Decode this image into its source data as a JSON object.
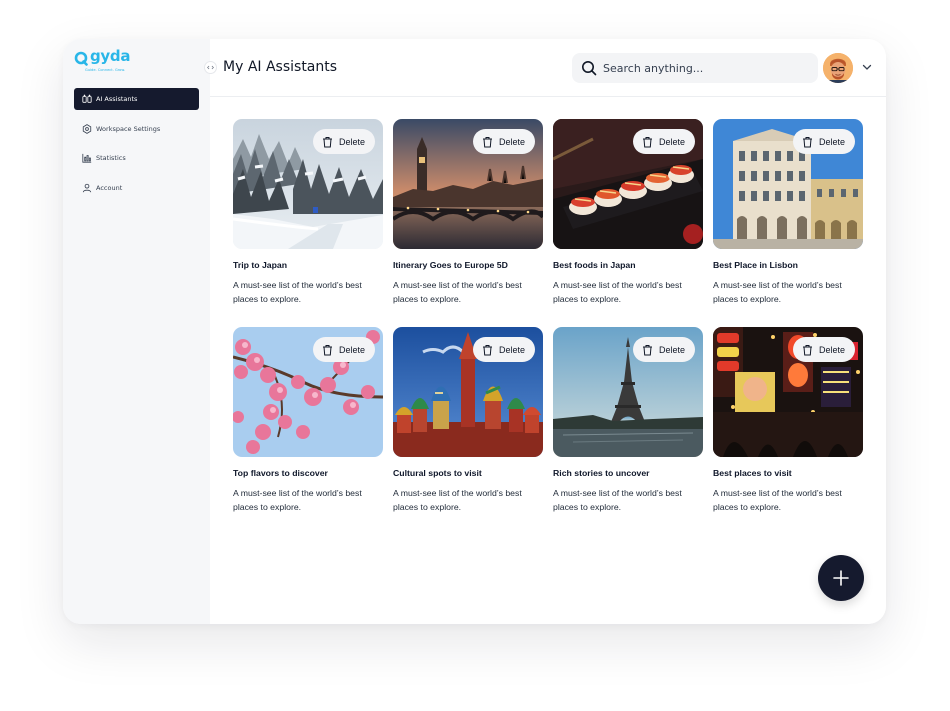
{
  "brand": {
    "name": "gyda",
    "tagline": "Guide. Connect. Grow.",
    "color": "#29b6e8"
  },
  "sidebar": {
    "items": [
      {
        "label": "AI Assistants",
        "icon": "assistants-icon",
        "active": true
      },
      {
        "label": "Workspace Settings",
        "icon": "settings-icon",
        "active": false
      },
      {
        "label": "Statistics",
        "icon": "chart-icon",
        "active": false
      },
      {
        "label": "Account",
        "icon": "user-icon",
        "active": false
      }
    ]
  },
  "header": {
    "title": "My AI Assistants",
    "search_placeholder": "Search anything..."
  },
  "cards": [
    {
      "title": "Trip to Japan",
      "desc": "A must-see list of the world’s best places to explore.",
      "delete_label": "Delete",
      "scene": "snowy-forest"
    },
    {
      "title": "Itinerary Goes to Europe 5D",
      "desc": "A must-see list of the world’s best places to explore.",
      "delete_label": "Delete",
      "scene": "london-bridge-sunset"
    },
    {
      "title": "Best foods in Japan",
      "desc": "A must-see list of the world’s best places to explore.",
      "delete_label": "Delete",
      "scene": "sushi"
    },
    {
      "title": "Best Place in Lisbon",
      "desc": "A must-see list of the world’s best places to explore.",
      "delete_label": "Delete",
      "scene": "lisbon-building"
    },
    {
      "title": "Top flavors to discover",
      "desc": "A must-see list of the world’s best places to explore.",
      "delete_label": "Delete",
      "scene": "cherry-blossom"
    },
    {
      "title": "Cultural spots to visit",
      "desc": "A must-see list of the world’s best places to explore.",
      "delete_label": "Delete",
      "scene": "st-basil-cathedral"
    },
    {
      "title": "Rich stories to uncover",
      "desc": "A must-see list of the world’s best places to explore.",
      "delete_label": "Delete",
      "scene": "eiffel-tower"
    },
    {
      "title": "Best places to visit",
      "desc": "A must-see list of the world’s best places to explore.",
      "delete_label": "Delete",
      "scene": "osaka-signs"
    }
  ],
  "colors": {
    "accent": "#151a2e",
    "search_bg": "#f3f4f6",
    "sidebar_bg": "#f6f7f9"
  }
}
